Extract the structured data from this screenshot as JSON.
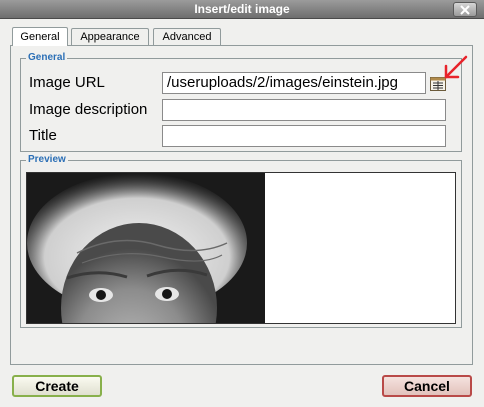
{
  "window": {
    "title": "Insert/edit image"
  },
  "tabs": [
    {
      "label": "General",
      "active": true
    },
    {
      "label": "Appearance",
      "active": false
    },
    {
      "label": "Advanced",
      "active": false
    }
  ],
  "general": {
    "legend": "General",
    "fields": {
      "image_url": {
        "label": "Image URL",
        "value": "/useruploads/2/images/einstein.jpg"
      },
      "image_description": {
        "label": "Image description",
        "value": ""
      },
      "title": {
        "label": "Title",
        "value": ""
      }
    }
  },
  "preview": {
    "legend": "Preview"
  },
  "buttons": {
    "create": "Create",
    "cancel": "Cancel"
  },
  "icons": {
    "close": "close-icon",
    "browse": "file-browser-icon",
    "annotation": "red-arrow-icon"
  },
  "colors": {
    "legend": "#2b6fb6",
    "create_border": "#88b04b",
    "cancel_border": "#b94a48",
    "annotation": "#e8232a"
  }
}
